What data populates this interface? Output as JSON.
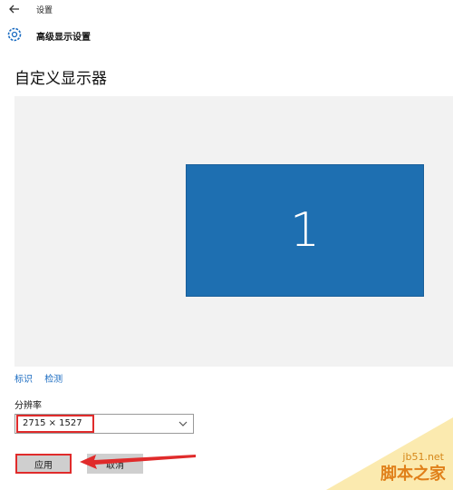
{
  "window": {
    "title": "设置"
  },
  "header": {
    "title": "高级显示设置"
  },
  "page": {
    "title": "自定义显示器"
  },
  "display": {
    "monitor_number": "1",
    "monitor_color": "#1e6fb1",
    "panel_color": "#f2f2f2"
  },
  "links": {
    "identify": "标识",
    "detect": "检测"
  },
  "resolution": {
    "label": "分辨率",
    "value": "2715 × 1527"
  },
  "buttons": {
    "apply": "应用",
    "cancel": "取消"
  },
  "annotation": {
    "color": "#e02b2b"
  },
  "watermark": {
    "url": "jb51.net",
    "name": "脚本之家"
  },
  "icons": [
    "back-arrow-icon",
    "gear-icon",
    "chevron-down-icon"
  ]
}
